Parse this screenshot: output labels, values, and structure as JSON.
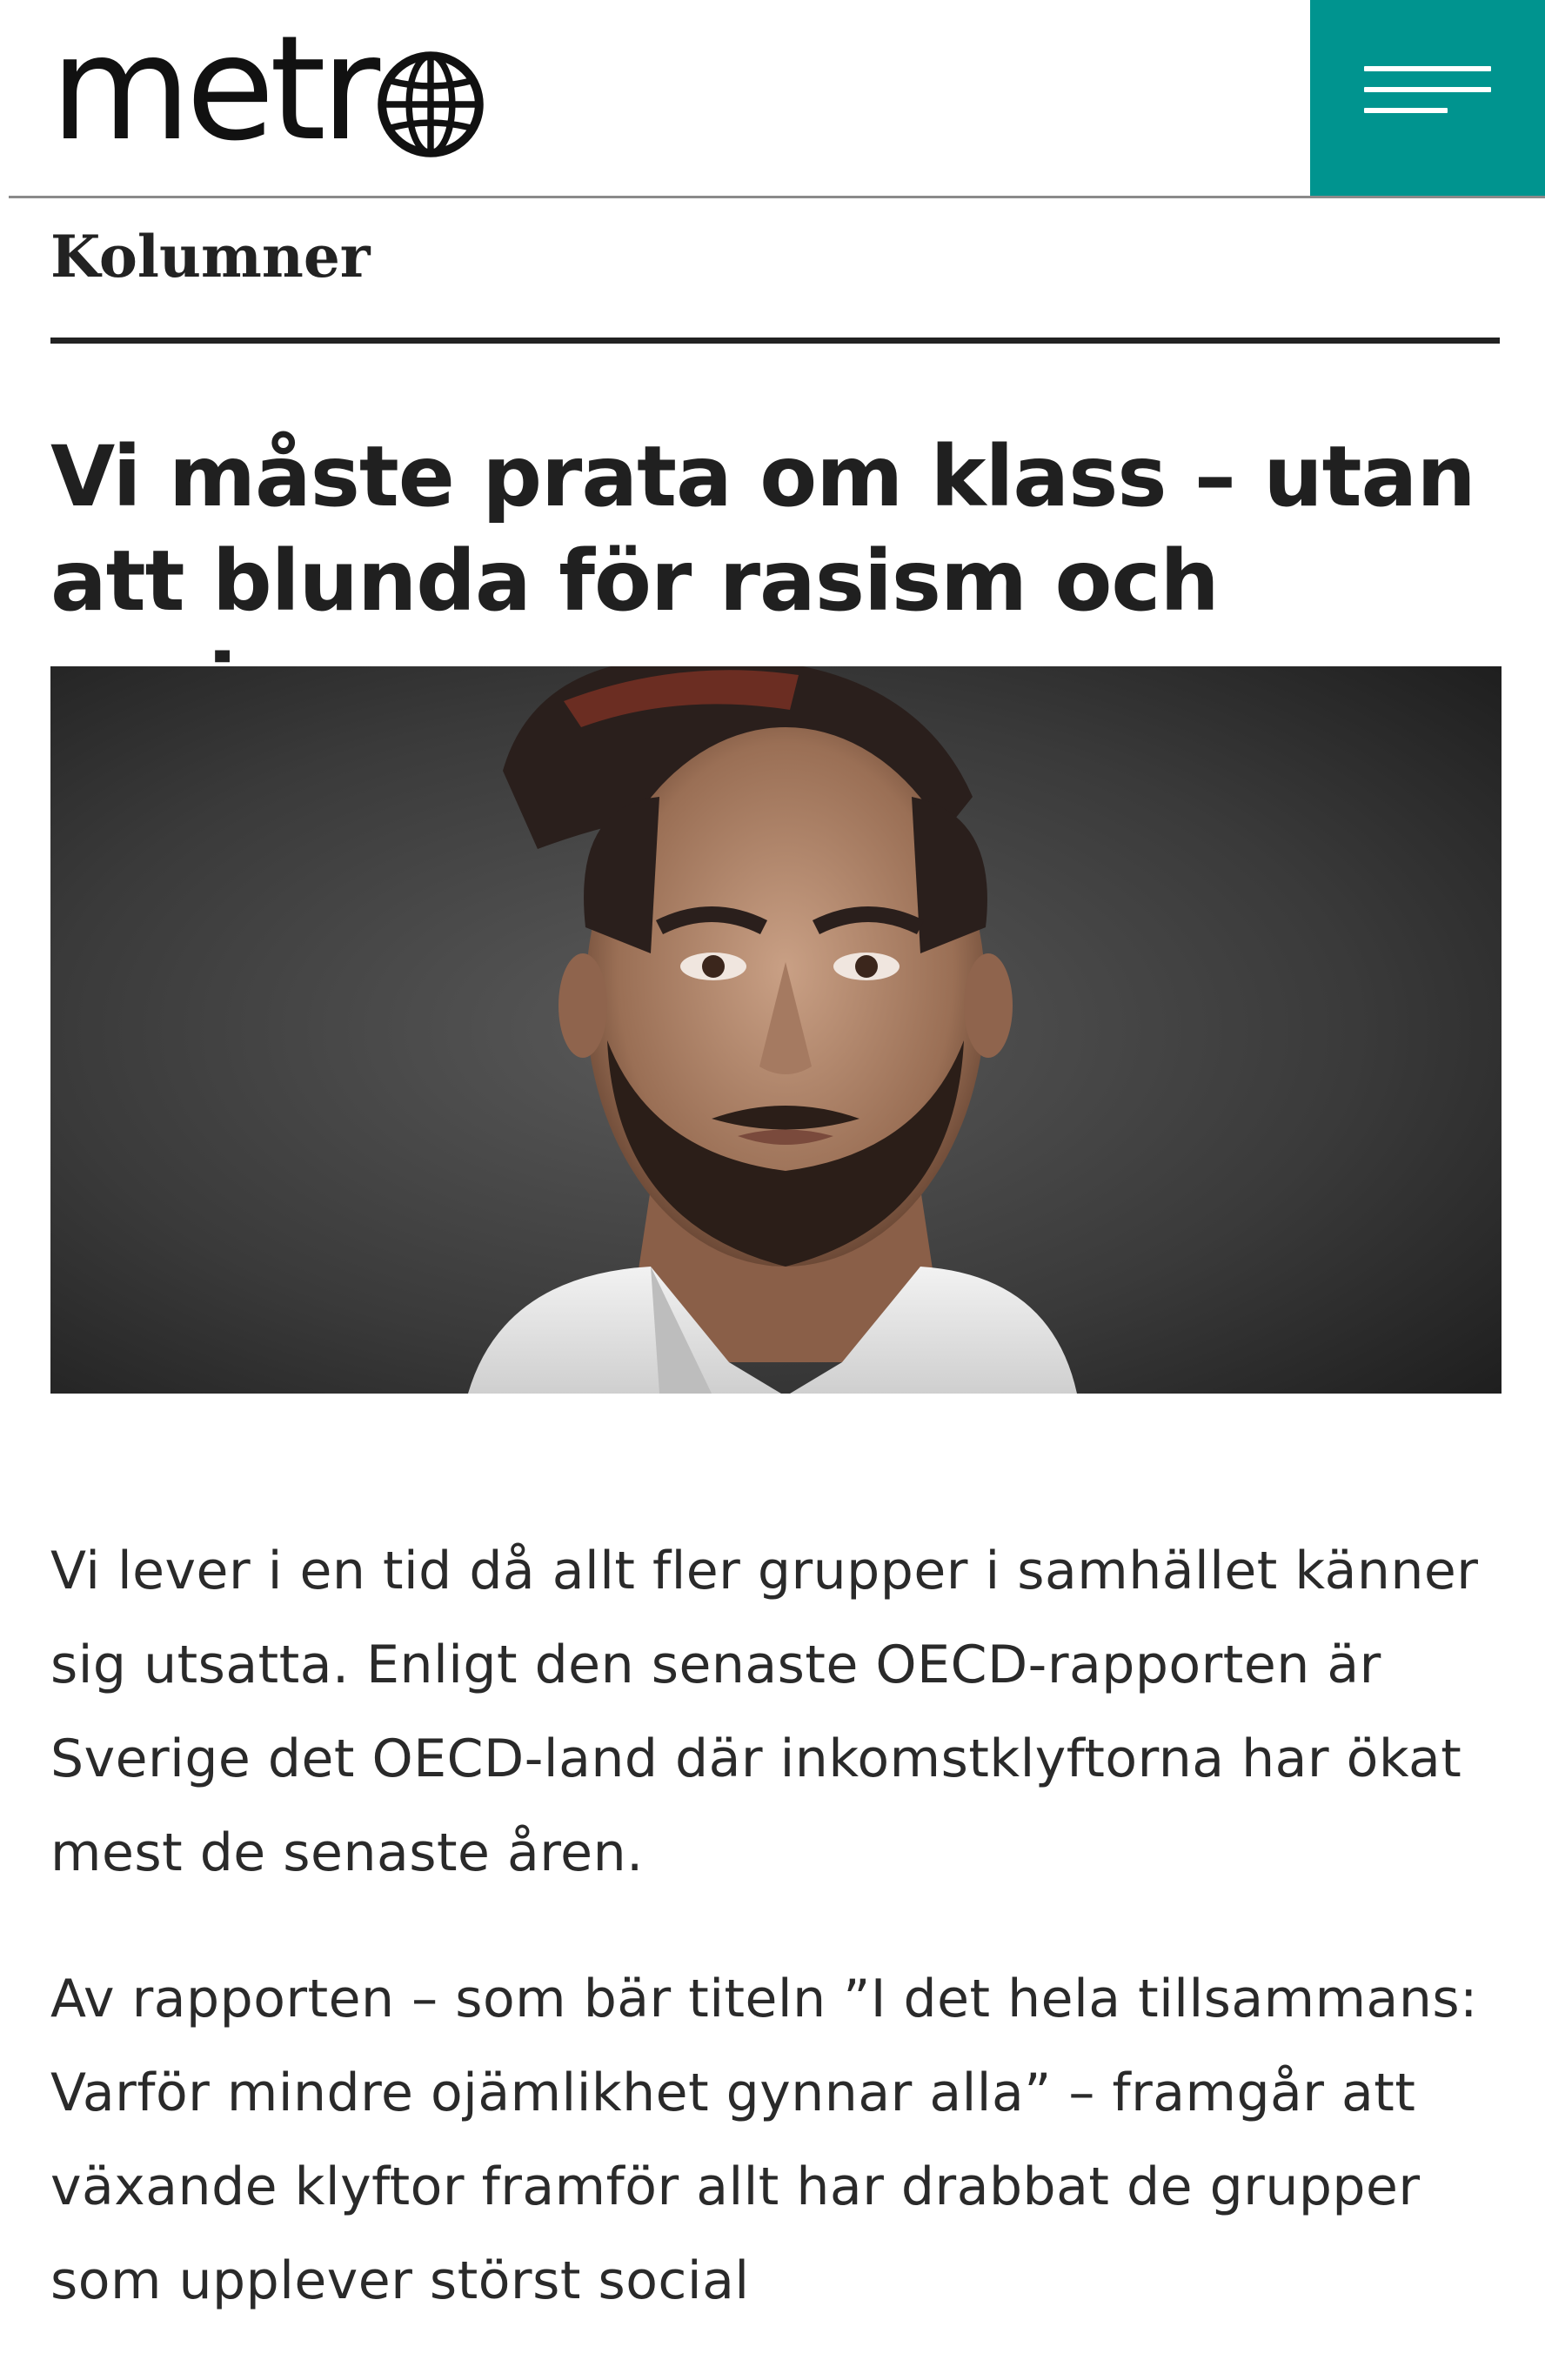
{
  "header": {
    "logo_text": "metr",
    "logo_icon": "globe-icon",
    "menu_icon": "hamburger-menu-icon",
    "accent_color": "#00948f"
  },
  "section": {
    "label": "Kolumner"
  },
  "article": {
    "title": "Vi måste prata om klass – utan att blunda för rasism och sexism",
    "paragraphs": [
      "Vi lever i en tid då allt fler grupper i samhället känner sig utsatta. Enligt den senaste OECD-rapporten är Sverige det OECD-land där inkomstklyftorna har ökat mest de senaste åren.",
      "Av rapporten – som bär titeln ”I det hela tillsammans: Varför mindre ojämlikhet gynnar alla” – framgår att växande klyftor framför allt har drabbat de grupper som upplever störst social"
    ]
  }
}
